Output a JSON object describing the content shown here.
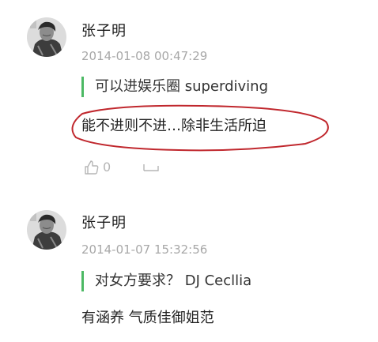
{
  "comments": [
    {
      "username": "张子明",
      "timestamp": "2014-01-08 00:47:29",
      "quote": "可以进娱乐圈 superdiving",
      "body": "能不进则不进…除非生活所迫",
      "likes": "0",
      "icons": [
        "avatar",
        "thumbs-up-icon",
        "reply-icon"
      ],
      "annotation_color": "#c0272d"
    },
    {
      "username": "张子明",
      "timestamp": "2014-01-07 15:32:56",
      "quote": "对女方要求？ DJ Cecllia",
      "body": "有涵养 气质佳御姐范"
    }
  ],
  "colors": {
    "quote_bar": "#4cb964",
    "timestamp": "#a8a8a8",
    "action_icons": "#b5b5b5"
  }
}
